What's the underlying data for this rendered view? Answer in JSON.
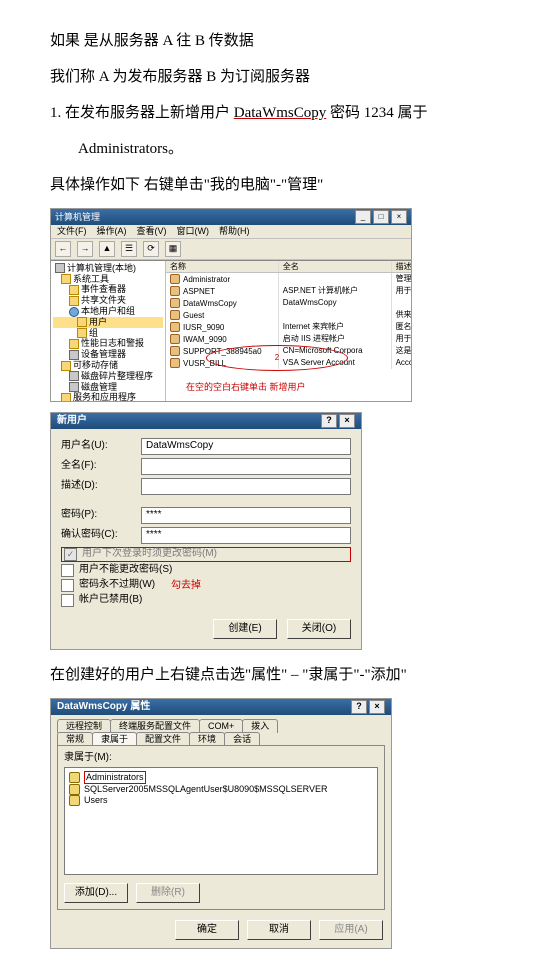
{
  "paragraphs": {
    "p1": "如果 是从服务器 A 往 B 传数据",
    "p2": "我们称 A 为发布服务器 B 为订阅服务器",
    "p3_a": "1. 在发布服务器上新增用户 ",
    "p3_user": "DataWmsCopy",
    "p3_b": " 密码 1234 属于",
    "p3_c": "Administrators。",
    "p4": "具体操作如下 右键单击\"我的电脑\"-\"管理\"",
    "p5": "在创建好的用户上右键点击选\"属性\" – \"隶属于\"-\"添加\""
  },
  "cm": {
    "title": "计算机管理",
    "menu": {
      "file": "文件(F)",
      "action": "操作(A)",
      "view": "查看(V)",
      "window": "窗口(W)",
      "help": "帮助(H)"
    },
    "tree": {
      "root": "计算机管理(本地)",
      "sys": "系统工具",
      "event": "事件查看器",
      "shared": "共享文件夹",
      "localusers": "本地用户和组",
      "users": "用户",
      "groups": "组",
      "perf": "性能日志和警报",
      "devmgr": "设备管理器",
      "storage": "可移动存储",
      "defrag": "磁盘碎片整理程序",
      "diskmgr": "磁盘管理",
      "svcapp": "服务和应用程序"
    },
    "cols": {
      "name": "名称",
      "full": "全名",
      "desc": "描述"
    },
    "rows": [
      {
        "n": "Administrator",
        "f": "",
        "d": "管理计算机(域)的"
      },
      {
        "n": "ASPNET",
        "f": "ASP.NET 计算机帐户",
        "d": "用于运行 ASP.NE"
      },
      {
        "n": "DataWmsCopy",
        "f": "DataWmsCopy",
        "d": ""
      },
      {
        "n": "Guest",
        "f": "",
        "d": "供来宾访问计算机"
      },
      {
        "n": "IUSR_9090",
        "f": "Internet 来宾帐户",
        "d": "匿名访问 Intern"
      },
      {
        "n": "IWAM_9090",
        "f": "启动 IIS 进程帐户",
        "d": "用于启动进程外应"
      },
      {
        "n": "SUPPORT_388945a0",
        "f": "CN=Microsoft Corpora",
        "d": "这是一个帮助和支"
      },
      {
        "n": "VUSR_BILL",
        "f": "VSA Server Account",
        "d": "Account for the"
      }
    ],
    "ellipse_n": "2",
    "hint": "在空的空白右键单击 新增用户"
  },
  "nu": {
    "title": "新用户",
    "labels": {
      "user": "用户名(U):",
      "full": "全名(F):",
      "desc": "描述(D):",
      "pwd": "密码(P):",
      "cpwd": "确认密码(C):"
    },
    "vals": {
      "user": "DataWmsCopy",
      "pwd": "****",
      "cpwd": "****"
    },
    "chk": {
      "must_change": "用户下次登录时须更改密码(M)",
      "cant_change": "用户不能更改密码(S)",
      "never_exp": "密码永不过期(W)",
      "disabled": "帐户已禁用(B)"
    },
    "note": "勾去掉",
    "btn_create": "创建(E)",
    "btn_close": "关闭(O)"
  },
  "pr": {
    "title": "DataWmsCopy 属性",
    "tabs_r1": {
      "remote": "远程控制",
      "tsprof": "终端服务配置文件",
      "com": "COM+",
      "dialin": "拨入"
    },
    "tabs_r2": {
      "general": "常规",
      "member": "隶属于",
      "profile": "配置文件",
      "env": "环境",
      "session": "会话"
    },
    "group_label": "隶属于(M):",
    "list": {
      "admins": "Administrators",
      "sqlagent": "SQLServer2005MSSQLAgentUser$U8090$MSSQLSERVER",
      "users": "Users"
    },
    "btn_add": "添加(D)...",
    "btn_remove": "删除(R)",
    "btn_ok": "确定",
    "btn_cancel": "取消",
    "btn_apply": "应用(A)"
  }
}
